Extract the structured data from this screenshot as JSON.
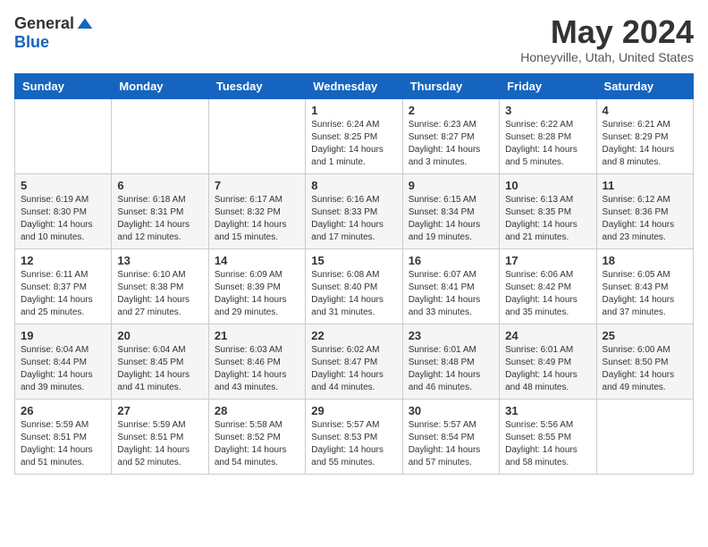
{
  "header": {
    "logo_general": "General",
    "logo_blue": "Blue",
    "month_title": "May 2024",
    "location": "Honeyville, Utah, United States"
  },
  "days_of_week": [
    "Sunday",
    "Monday",
    "Tuesday",
    "Wednesday",
    "Thursday",
    "Friday",
    "Saturday"
  ],
  "weeks": [
    [
      {
        "day": "",
        "sunrise": "",
        "sunset": "",
        "daylight": ""
      },
      {
        "day": "",
        "sunrise": "",
        "sunset": "",
        "daylight": ""
      },
      {
        "day": "",
        "sunrise": "",
        "sunset": "",
        "daylight": ""
      },
      {
        "day": "1",
        "sunrise": "Sunrise: 6:24 AM",
        "sunset": "Sunset: 8:25 PM",
        "daylight": "Daylight: 14 hours and 1 minute."
      },
      {
        "day": "2",
        "sunrise": "Sunrise: 6:23 AM",
        "sunset": "Sunset: 8:27 PM",
        "daylight": "Daylight: 14 hours and 3 minutes."
      },
      {
        "day": "3",
        "sunrise": "Sunrise: 6:22 AM",
        "sunset": "Sunset: 8:28 PM",
        "daylight": "Daylight: 14 hours and 5 minutes."
      },
      {
        "day": "4",
        "sunrise": "Sunrise: 6:21 AM",
        "sunset": "Sunset: 8:29 PM",
        "daylight": "Daylight: 14 hours and 8 minutes."
      }
    ],
    [
      {
        "day": "5",
        "sunrise": "Sunrise: 6:19 AM",
        "sunset": "Sunset: 8:30 PM",
        "daylight": "Daylight: 14 hours and 10 minutes."
      },
      {
        "day": "6",
        "sunrise": "Sunrise: 6:18 AM",
        "sunset": "Sunset: 8:31 PM",
        "daylight": "Daylight: 14 hours and 12 minutes."
      },
      {
        "day": "7",
        "sunrise": "Sunrise: 6:17 AM",
        "sunset": "Sunset: 8:32 PM",
        "daylight": "Daylight: 14 hours and 15 minutes."
      },
      {
        "day": "8",
        "sunrise": "Sunrise: 6:16 AM",
        "sunset": "Sunset: 8:33 PM",
        "daylight": "Daylight: 14 hours and 17 minutes."
      },
      {
        "day": "9",
        "sunrise": "Sunrise: 6:15 AM",
        "sunset": "Sunset: 8:34 PM",
        "daylight": "Daylight: 14 hours and 19 minutes."
      },
      {
        "day": "10",
        "sunrise": "Sunrise: 6:13 AM",
        "sunset": "Sunset: 8:35 PM",
        "daylight": "Daylight: 14 hours and 21 minutes."
      },
      {
        "day": "11",
        "sunrise": "Sunrise: 6:12 AM",
        "sunset": "Sunset: 8:36 PM",
        "daylight": "Daylight: 14 hours and 23 minutes."
      }
    ],
    [
      {
        "day": "12",
        "sunrise": "Sunrise: 6:11 AM",
        "sunset": "Sunset: 8:37 PM",
        "daylight": "Daylight: 14 hours and 25 minutes."
      },
      {
        "day": "13",
        "sunrise": "Sunrise: 6:10 AM",
        "sunset": "Sunset: 8:38 PM",
        "daylight": "Daylight: 14 hours and 27 minutes."
      },
      {
        "day": "14",
        "sunrise": "Sunrise: 6:09 AM",
        "sunset": "Sunset: 8:39 PM",
        "daylight": "Daylight: 14 hours and 29 minutes."
      },
      {
        "day": "15",
        "sunrise": "Sunrise: 6:08 AM",
        "sunset": "Sunset: 8:40 PM",
        "daylight": "Daylight: 14 hours and 31 minutes."
      },
      {
        "day": "16",
        "sunrise": "Sunrise: 6:07 AM",
        "sunset": "Sunset: 8:41 PM",
        "daylight": "Daylight: 14 hours and 33 minutes."
      },
      {
        "day": "17",
        "sunrise": "Sunrise: 6:06 AM",
        "sunset": "Sunset: 8:42 PM",
        "daylight": "Daylight: 14 hours and 35 minutes."
      },
      {
        "day": "18",
        "sunrise": "Sunrise: 6:05 AM",
        "sunset": "Sunset: 8:43 PM",
        "daylight": "Daylight: 14 hours and 37 minutes."
      }
    ],
    [
      {
        "day": "19",
        "sunrise": "Sunrise: 6:04 AM",
        "sunset": "Sunset: 8:44 PM",
        "daylight": "Daylight: 14 hours and 39 minutes."
      },
      {
        "day": "20",
        "sunrise": "Sunrise: 6:04 AM",
        "sunset": "Sunset: 8:45 PM",
        "daylight": "Daylight: 14 hours and 41 minutes."
      },
      {
        "day": "21",
        "sunrise": "Sunrise: 6:03 AM",
        "sunset": "Sunset: 8:46 PM",
        "daylight": "Daylight: 14 hours and 43 minutes."
      },
      {
        "day": "22",
        "sunrise": "Sunrise: 6:02 AM",
        "sunset": "Sunset: 8:47 PM",
        "daylight": "Daylight: 14 hours and 44 minutes."
      },
      {
        "day": "23",
        "sunrise": "Sunrise: 6:01 AM",
        "sunset": "Sunset: 8:48 PM",
        "daylight": "Daylight: 14 hours and 46 minutes."
      },
      {
        "day": "24",
        "sunrise": "Sunrise: 6:01 AM",
        "sunset": "Sunset: 8:49 PM",
        "daylight": "Daylight: 14 hours and 48 minutes."
      },
      {
        "day": "25",
        "sunrise": "Sunrise: 6:00 AM",
        "sunset": "Sunset: 8:50 PM",
        "daylight": "Daylight: 14 hours and 49 minutes."
      }
    ],
    [
      {
        "day": "26",
        "sunrise": "Sunrise: 5:59 AM",
        "sunset": "Sunset: 8:51 PM",
        "daylight": "Daylight: 14 hours and 51 minutes."
      },
      {
        "day": "27",
        "sunrise": "Sunrise: 5:59 AM",
        "sunset": "Sunset: 8:51 PM",
        "daylight": "Daylight: 14 hours and 52 minutes."
      },
      {
        "day": "28",
        "sunrise": "Sunrise: 5:58 AM",
        "sunset": "Sunset: 8:52 PM",
        "daylight": "Daylight: 14 hours and 54 minutes."
      },
      {
        "day": "29",
        "sunrise": "Sunrise: 5:57 AM",
        "sunset": "Sunset: 8:53 PM",
        "daylight": "Daylight: 14 hours and 55 minutes."
      },
      {
        "day": "30",
        "sunrise": "Sunrise: 5:57 AM",
        "sunset": "Sunset: 8:54 PM",
        "daylight": "Daylight: 14 hours and 57 minutes."
      },
      {
        "day": "31",
        "sunrise": "Sunrise: 5:56 AM",
        "sunset": "Sunset: 8:55 PM",
        "daylight": "Daylight: 14 hours and 58 minutes."
      },
      {
        "day": "",
        "sunrise": "",
        "sunset": "",
        "daylight": ""
      }
    ]
  ]
}
